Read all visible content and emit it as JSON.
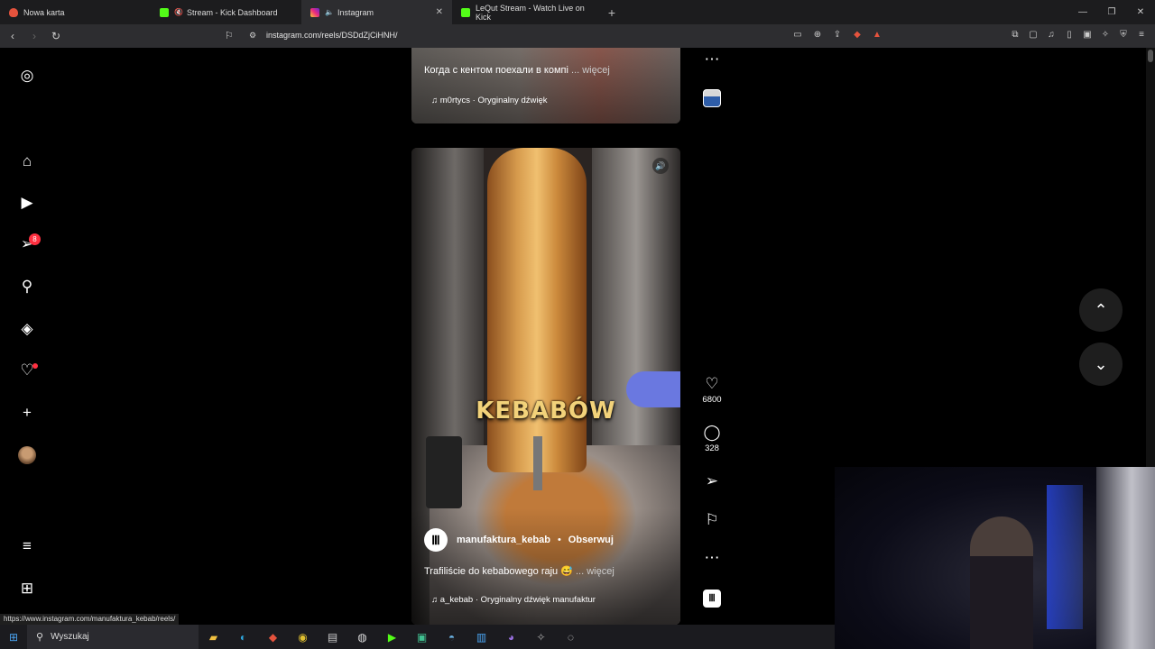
{
  "browser": {
    "tabs": [
      {
        "label": "Nowa karta",
        "color": "#e5533d",
        "active": false,
        "muted": false
      },
      {
        "label": "Stream - Kick Dashboard",
        "color": "#53fc18",
        "active": false,
        "muted": true
      },
      {
        "label": "Instagram",
        "color": "#d6249f",
        "active": true,
        "muted": true
      },
      {
        "label": "LeQut Stream - Watch Live on Kick",
        "color": "#53fc18",
        "active": false,
        "muted": false
      }
    ],
    "new_tab": "+",
    "url": "instagram.com/reels/DSDdZjCiHNH/",
    "status_url": "https://www.instagram.com/manufaktura_kebab/reels/"
  },
  "sidebar": {
    "notifications_badge": "8",
    "items": [
      "instagram-logo",
      "home",
      "reels",
      "messages",
      "search",
      "explore",
      "notifications",
      "create",
      "profile",
      "more",
      "apps"
    ]
  },
  "reel_top": {
    "caption": "Когда с кентом поехали в компі",
    "more": "... więcej",
    "audio": "m0rtycs · Oryginalny dźwięk"
  },
  "reel_main": {
    "overlay_text": "KEBABÓW",
    "author": "manufaktura_kebab",
    "dot": "•",
    "follow": "Obserwuj",
    "caption": "Trafiliście do kebabowego raju 😅",
    "more": "... więcej",
    "audio": "a_kebab · Oryginalny dźwięk  manufaktur"
  },
  "actions": {
    "likes": "6800",
    "comments": "328"
  },
  "taskbar": {
    "search_placeholder": "Wyszukaj"
  },
  "colors": {
    "badge": "#ff3040",
    "webcam_light": "#2846dc"
  }
}
